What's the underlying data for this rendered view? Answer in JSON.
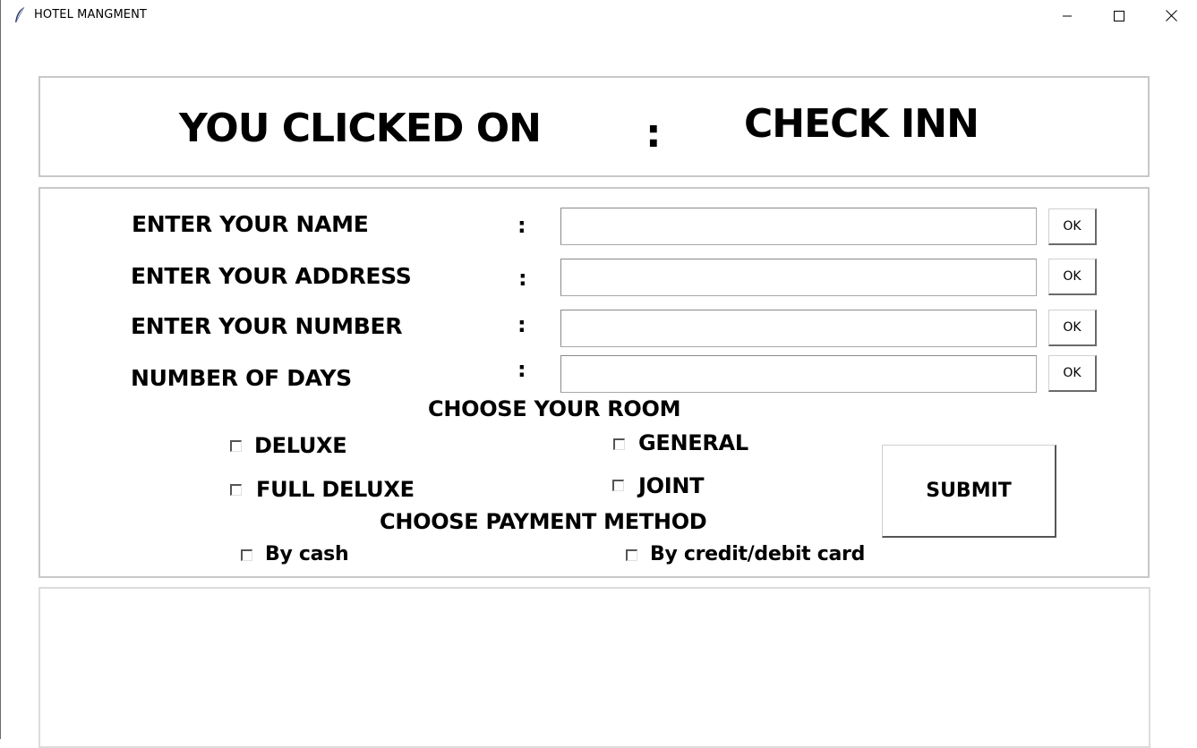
{
  "window": {
    "title": "HOTEL MANGMENT",
    "icon": "feather-icon",
    "controls": [
      "minimize-icon",
      "maximize-icon",
      "close-icon"
    ]
  },
  "header": {
    "left_text": "YOU CLICKED ON",
    "separator": ":",
    "right_text": "CHECK INN"
  },
  "form": {
    "rows": [
      {
        "label": "ENTER YOUR NAME",
        "colon": ":",
        "value": "",
        "button": "OK"
      },
      {
        "label": "ENTER YOUR ADDRESS",
        "colon": ":",
        "value": "",
        "button": "OK"
      },
      {
        "label": "ENTER YOUR NUMBER",
        "colon": ":",
        "value": "",
        "button": "OK"
      },
      {
        "label": "NUMBER OF DAYS",
        "colon": ":",
        "value": "",
        "button": "OK"
      }
    ],
    "room_title": "CHOOSE YOUR ROOM",
    "rooms": [
      {
        "label": "DELUXE",
        "checked": false
      },
      {
        "label": "GENERAL",
        "checked": false
      },
      {
        "label": "FULL DELUXE",
        "checked": false
      },
      {
        "label": "JOINT",
        "checked": false
      }
    ],
    "payment_title": "CHOOSE PAYMENT METHOD",
    "payments": [
      {
        "label": "By cash",
        "checked": false
      },
      {
        "label": "By credit/debit card",
        "checked": false
      }
    ],
    "submit_label": "SUBMIT"
  },
  "output": {
    "text": ""
  }
}
